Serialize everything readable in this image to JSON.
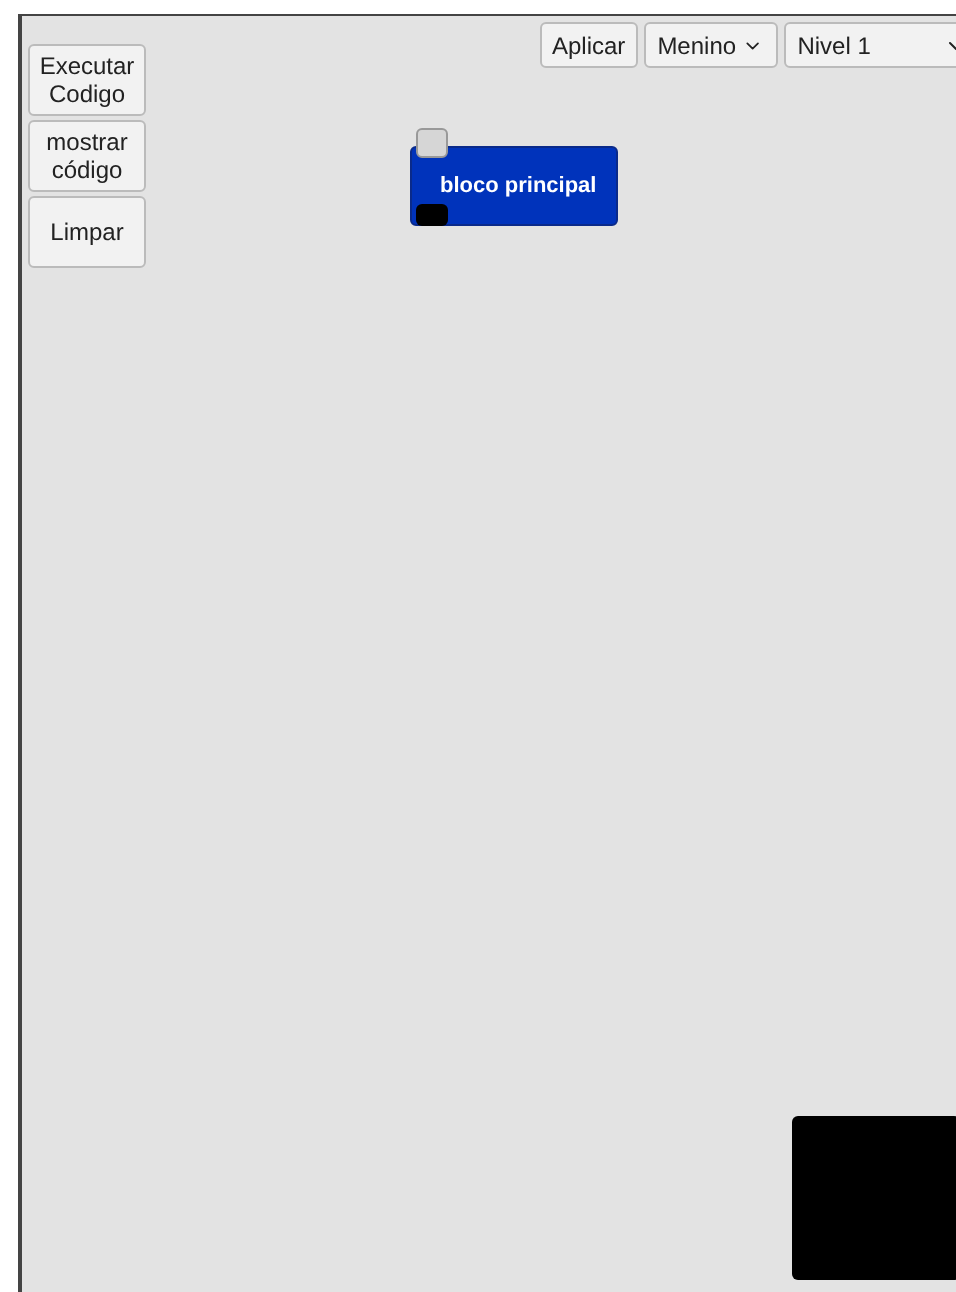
{
  "side_buttons": [
    {
      "label": "Executar Codigo"
    },
    {
      "label": "mostrar código"
    },
    {
      "label": "Limpar"
    }
  ],
  "toolbar": {
    "apply_button": "Aplicar",
    "character_select": {
      "value": "Menino"
    },
    "level_select": {
      "value": "Nivel 1"
    }
  },
  "workspace": {
    "block": {
      "label": "bloco principal"
    }
  }
}
